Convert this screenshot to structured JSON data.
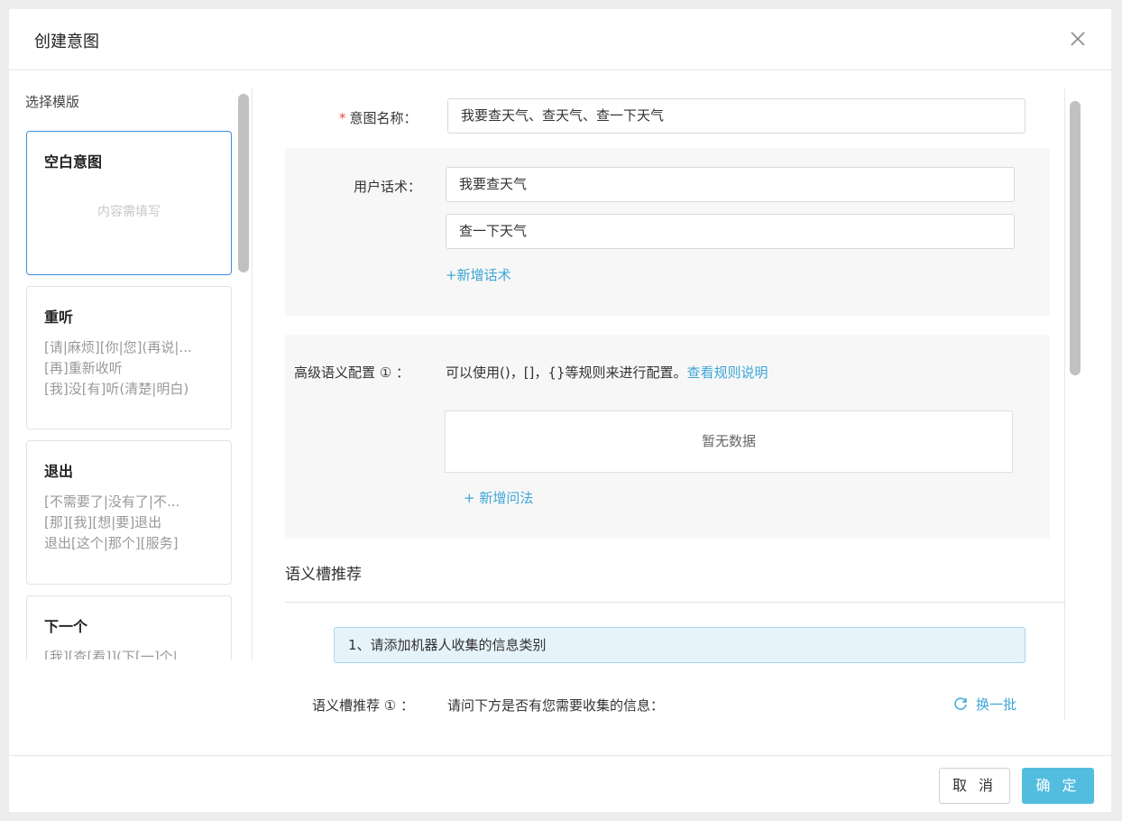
{
  "dialog": {
    "title": "创建意图"
  },
  "templates": {
    "label": "选择模版",
    "cards": [
      {
        "title": "空白意图",
        "placeholder": "内容需填写"
      },
      {
        "title": "重听",
        "lines": [
          "[请|麻烦][你|您](再说|...",
          "[再]重新收听",
          "[我]没[有]听(清楚|明白)"
        ]
      },
      {
        "title": "退出",
        "lines": [
          "[不需要了|没有了|不...",
          "[那][我][想|要]退出",
          "退出[这个|那个][服务]"
        ]
      },
      {
        "title": "下一个",
        "lines": [
          "[我][查[看]](下[一]个|..."
        ]
      }
    ]
  },
  "form": {
    "intent_name": {
      "required_mark": "*",
      "label": "意图名称：",
      "value": "我要查天气、查天气、查一下天气"
    },
    "utterances": {
      "label": "用户话术：",
      "values": [
        "我要查天气",
        "查一下天气"
      ],
      "add_link": "+新增话术"
    },
    "advanced": {
      "label": "高级语义配置 ① ：",
      "description": "可以使用()，[]，{}等规则来进行配置。",
      "rules_link": "查看规则说明",
      "empty_text": "暂无数据",
      "add_link": "+ 新增问法"
    },
    "slot_section": {
      "title": "语义槽推荐",
      "banner": "1、请添加机器人收集的信息类别",
      "label": "语义槽推荐 ① ：",
      "question": "请问下方是否有您需要收集的信息：",
      "refresh_link": "换一批"
    }
  },
  "footer": {
    "cancel": "取 消",
    "confirm": "确 定"
  },
  "colors": {
    "accent": "#3ea6d6",
    "primary_button": "#53bde0",
    "required": "#e84b3c",
    "selected_border": "#3b8ee0"
  }
}
